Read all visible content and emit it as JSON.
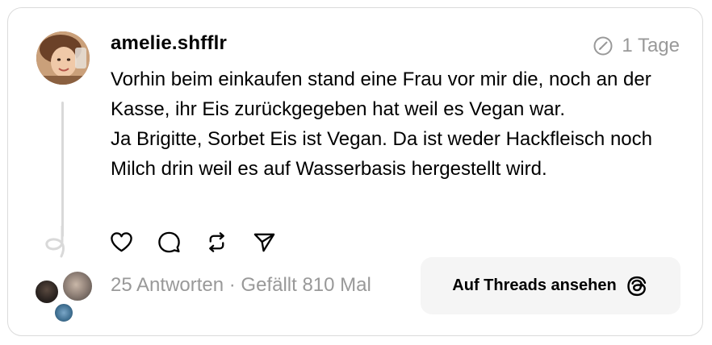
{
  "post": {
    "username": "amelie.shfflr",
    "time_ago": "1 Tage",
    "text_lines": [
      "Vorhin beim einkaufen stand eine Frau vor mir die, noch an der Kasse, ihr Eis zurückgegeben hat weil es Vegan war.",
      "Ja Brigitte, Sorbet Eis ist Vegan. Da ist weder Hackfleisch noch Milch drin weil es auf Wasserbasis hergestellt wird."
    ]
  },
  "actions": {
    "icons": [
      "heart-icon",
      "comment-icon",
      "repost-icon",
      "share-icon"
    ]
  },
  "stats": {
    "text": "25 Antworten · Gefällt 810 Mal"
  },
  "open_button": {
    "label": "Auf Threads ansehen"
  },
  "colors": {
    "text": "#000000",
    "muted": "#999999",
    "border": "#dbdbdb",
    "button_bg": "#f5f5f5",
    "thread_line": "#d9d9d9"
  }
}
